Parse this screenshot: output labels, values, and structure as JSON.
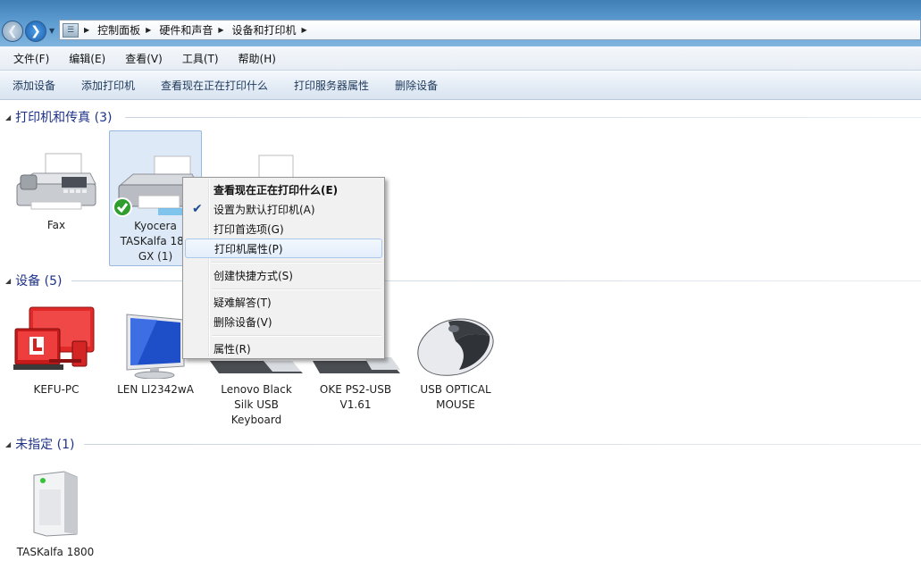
{
  "address": {
    "crumbs": [
      "控制面板",
      "硬件和声音",
      "设备和打印机"
    ]
  },
  "menubar": {
    "items": [
      "文件(F)",
      "编辑(E)",
      "查看(V)",
      "工具(T)",
      "帮助(H)"
    ]
  },
  "commandbar": {
    "items": [
      "添加设备",
      "添加打印机",
      "查看现在正在打印什么",
      "打印服务器属性",
      "删除设备"
    ]
  },
  "groups": {
    "printers": {
      "header": "打印机和传真 (3)",
      "items": [
        {
          "label": "Fax"
        },
        {
          "label_lines": [
            "Kyocera",
            "TASKalfa 180",
            "GX (1)"
          ]
        },
        {
          "label": ""
        }
      ]
    },
    "devices": {
      "header": "设备 (5)",
      "items": [
        {
          "label": "KEFU-PC"
        },
        {
          "label": "LEN LI2342wA"
        },
        {
          "label_lines": [
            "Lenovo Black",
            "Silk USB",
            "Keyboard"
          ]
        },
        {
          "label_lines": [
            "OKE PS2-USB",
            "V1.61"
          ]
        },
        {
          "label_lines": [
            "USB OPTICAL",
            "MOUSE"
          ]
        }
      ]
    },
    "unspecified": {
      "header": "未指定 (1)",
      "items": [
        {
          "label": "TASKalfa 1800"
        }
      ]
    }
  },
  "context_menu": {
    "items": [
      {
        "label": "查看现在正在打印什么(E)",
        "bold": true
      },
      {
        "label": "设置为默认打印机(A)",
        "checked": true
      },
      {
        "label": "打印首选项(G)"
      },
      {
        "label": "打印机属性(P)",
        "hover": true
      },
      {
        "label": "创建快捷方式(S)"
      },
      {
        "label": "疑难解答(T)"
      },
      {
        "label": "删除设备(V)"
      },
      {
        "label": "属性(R)"
      }
    ]
  },
  "colors": {
    "header_text": "#1e3287",
    "selection_fill": "#dde9f7",
    "default_check": "#2f9e2f"
  },
  "icons": {
    "back": "back-arrow-icon",
    "forward": "forward-arrow-icon",
    "default_badge": "checkmark-badge-icon"
  }
}
